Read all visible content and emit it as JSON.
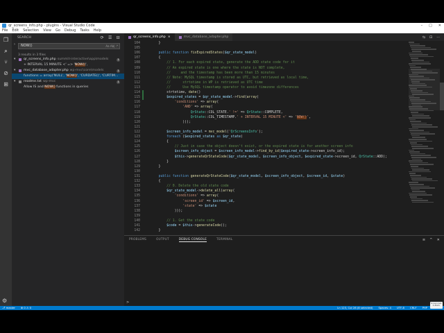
{
  "window": {
    "title": "qr_screens_info.php - plugins - Visual Studio Code",
    "controls": [
      "–",
      "□",
      "✕"
    ]
  },
  "menu": [
    "File",
    "Edit",
    "Selection",
    "View",
    "Go",
    "Debug",
    "Tasks",
    "Help"
  ],
  "activity_icons": [
    "files-icon",
    "search-icon",
    "source-control-icon",
    "debug-icon",
    "extensions-icon"
  ],
  "sidebar": {
    "header": "SEARCH",
    "actions": [
      "⟳",
      "☰",
      "⊟"
    ],
    "search_value": "NOW()",
    "search_opts": "Aa Ab| .*",
    "result_count": "3 results in 3 files",
    "results": [
      {
        "type": "file",
        "name": "qr_screens_info.php",
        "path": "summit-interactive\\app\\models",
        "count": "1"
      },
      {
        "type": "match",
        "text": "+ INTERVAL 15 MINUTE <' => 'NOW()',",
        "highlight": "NOW()"
      },
      {
        "type": "file",
        "name": "mvc_database_adapter.php",
        "path": "wp-mvc\\core\\models",
        "count": "1"
      },
      {
        "type": "match",
        "text": "functions = array('NULL', 'NOW()', 'CURDATE()', 'CURTIM...",
        "highlight": "NOW()"
      },
      {
        "type": "file",
        "name": "readme.txt",
        "path": "wp-mvc",
        "count": "1"
      },
      {
        "type": "match",
        "text": "Allow IS and NOW() functions in queries",
        "highlight": "NOW()"
      }
    ]
  },
  "tabs": [
    {
      "label": "qr_screens_info.php",
      "active": true
    },
    {
      "label": "mvc_database_adapter.php",
      "active": false
    }
  ],
  "tab_actions": [
    "⇆",
    "⊡",
    "···"
  ],
  "code": {
    "lines": [
      {
        "n": "104",
        "t": "    }"
      },
      {
        "n": "105",
        "t": ""
      },
      {
        "n": "106",
        "t": "    public function fixExpiredStates($qr_state_model)"
      },
      {
        "n": "107",
        "t": "    {"
      },
      {
        "n": "108",
        "t": "        // 1. For each expired state, generate the ADD state code for it"
      },
      {
        "n": "109",
        "t": "        // An expired state is one where the state is NOT complete,"
      },
      {
        "n": "110",
        "t": "        //     and the timestamp has been more than 15 minutes"
      },
      {
        "n": "111",
        "t": "        // Note: MySQL timestamp is stored as UTC, but retrieved as local time,"
      },
      {
        "n": "112",
        "t": "        //      strtotime in WP is retrieved as UTC time"
      },
      {
        "n": "113",
        "t": "        //      Use MySQL timestamp operator to avoid timezone differences"
      },
      {
        "n": "114",
        "t": "        strtotime, date()"
      },
      {
        "n": "115",
        "t": "        $expired_states = $qr_state_model->find(array("
      },
      {
        "n": "116",
        "t": "            'conditions' => array("
      },
      {
        "n": "117",
        "t": "                'AND' => array("
      },
      {
        "n": "118",
        "t": "                    QrState::COL_STATE.' !=' => QrState::COMPLETE,"
      },
      {
        "n": "119",
        "t": "                    QrState::COL_TIMESTAMP.' + INTERVAL 15 MINUTE <' => 'NOW()',"
      },
      {
        "n": "120",
        "t": "                )));"
      },
      {
        "n": "121",
        "t": ""
      },
      {
        "n": "122",
        "t": "        $screen_info_model = mvc_model('QrScreensInfo');"
      },
      {
        "n": "123",
        "t": "        foreach ($expired_states as $qr_state)"
      },
      {
        "n": "124",
        "t": "        {"
      },
      {
        "n": "125",
        "t": "            // Just in case the object doesn't exist, or the expired state is for another screen info"
      },
      {
        "n": "126",
        "t": "            $screen_info_object = $screen_info_model->find_by_id($expired_state->screen_info_id);"
      },
      {
        "n": "127",
        "t": "            $this->generateQrStateCode($qr_state_model, $screen_info_object, $expired_state->screen_id, QrState::ADD);"
      },
      {
        "n": "128",
        "t": "        }"
      },
      {
        "n": "129",
        "t": "    }"
      },
      {
        "n": "130",
        "t": ""
      },
      {
        "n": "131",
        "t": "    public function generateQrStateCode($qr_state_model, $screen_info_object, $screen_id, $state)"
      },
      {
        "n": "132",
        "t": "    {"
      },
      {
        "n": "133",
        "t": "        // 0. Delete the old state code"
      },
      {
        "n": "134",
        "t": "        $qr_state_model->delete_all(array("
      },
      {
        "n": "135",
        "t": "            'conditions' => array("
      },
      {
        "n": "136",
        "t": "                'screen_id' => $screen_id,"
      },
      {
        "n": "137",
        "t": "                'state' => $state"
      },
      {
        "n": "138",
        "t": "            )));"
      },
      {
        "n": "139",
        "t": ""
      },
      {
        "n": "140",
        "t": "        // 1. Get the state code"
      },
      {
        "n": "141",
        "t": "        $code = $this->generateCode();"
      },
      {
        "n": "142",
        "t": "    }"
      }
    ]
  },
  "panel": {
    "tabs": [
      {
        "label": "PROBLEMS",
        "active": false
      },
      {
        "label": "OUTPUT",
        "active": false
      },
      {
        "label": "DEBUG CONSOLE",
        "active": true
      },
      {
        "label": "TERMINAL",
        "active": false
      }
    ],
    "actions": [
      "≡",
      "^",
      "✕"
    ],
    "prompt": ">"
  },
  "status": {
    "left": [
      "⎇ master",
      "⊗ 0 ⚠ 0"
    ],
    "right": [
      "Ln 123, Col 28 (8 selected)",
      "Spaces: 4",
      "UTF-8",
      "CRLF",
      "PHP"
    ]
  },
  "watermark": "Screencast-O-Matic"
}
